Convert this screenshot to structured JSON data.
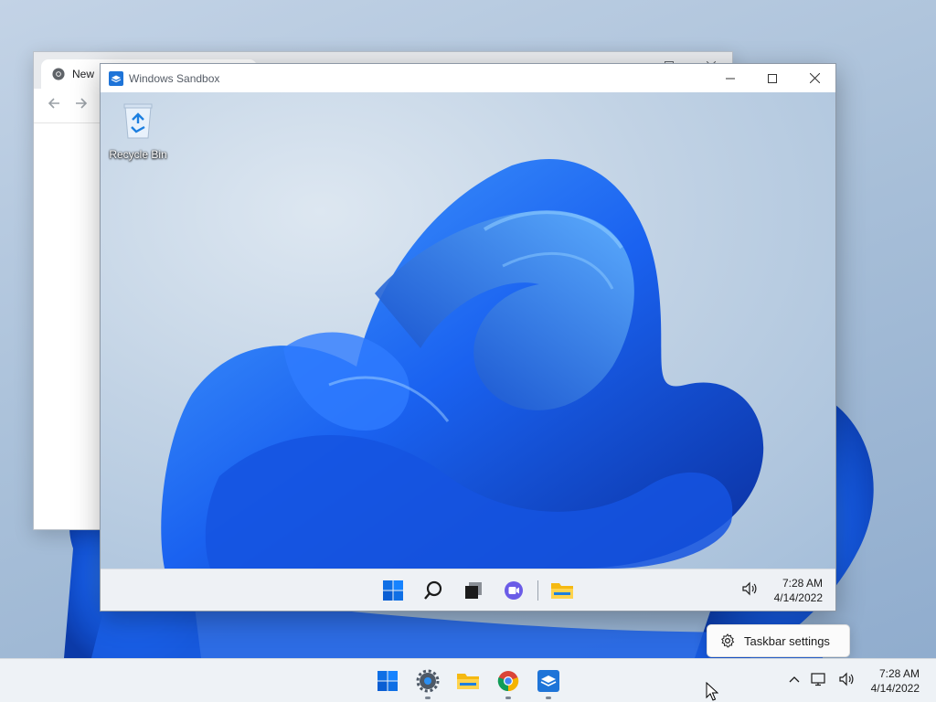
{
  "browser": {
    "tab_label": "New",
    "icon": "chrome-icon"
  },
  "sandbox": {
    "title": "Windows Sandbox",
    "icon": "windows-sandbox-icon",
    "desktop": {
      "recycle_bin_label": "Recycle Bin"
    },
    "taskbar": {
      "icons": [
        "start-icon",
        "search-icon",
        "task-view-icon",
        "chat-icon",
        "file-explorer-icon"
      ],
      "clock_time": "7:28 AM",
      "clock_date": "4/14/2022"
    }
  },
  "host_taskbar": {
    "icons": [
      "start-icon",
      "settings-icon",
      "file-explorer-icon",
      "chrome-icon",
      "windows-sandbox-icon"
    ],
    "clock_time": "7:28 AM",
    "clock_date": "4/14/2022"
  },
  "context_popup": {
    "label": "Taskbar settings"
  },
  "colors": {
    "accent": "#0067c0",
    "bloom_dark": "#0a3fbf",
    "bloom_light": "#2f86ff",
    "taskbar": "#eef2f6"
  }
}
